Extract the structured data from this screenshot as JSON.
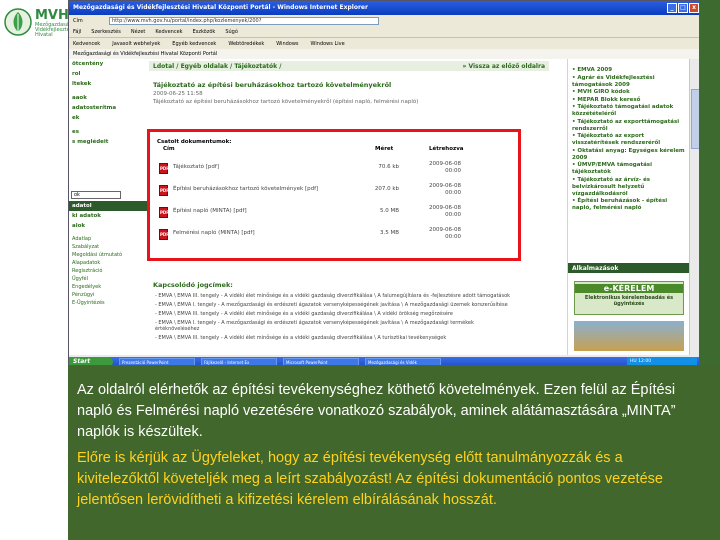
{
  "logo": {
    "title": "MVH",
    "subtitle": "Mezőgazdasági Vidékfejlesztési Hivatal"
  },
  "browser": {
    "title": "Mezőgazdasági és Vidékfejlesztési Hivatal Központi Portál - Windows Internet Explorer",
    "window_buttons": {
      "minimize": "_",
      "maximize": "□",
      "close": "x"
    },
    "address_label": "Cím",
    "address_value": "http://www.mvh.gov.hu/portal/index.php/kozlemenyek/200?",
    "menu": [
      "Fájl",
      "Szerkesztés",
      "Nézet",
      "Kedvencek",
      "Eszközök",
      "Súgó"
    ],
    "favorites": [
      "Kedvencek",
      "Javasolt webhelyek",
      "Egyéb kedvencek",
      "Webtöredékek",
      "Windows",
      "Windows Live"
    ],
    "tab": "Mezőgazdasági és Vidékfejlesztési Hivatal Központi Portál"
  },
  "left_nav": {
    "items": [
      "",
      "ötcentény",
      "rol",
      "ltekek",
      "",
      "aaok",
      "adatosterítma",
      "ek",
      "",
      "es",
      "s meglédeit",
      "",
      "",
      "",
      "",
      "",
      "",
      "",
      "",
      "",
      "",
      "",
      "ki adatok",
      "alok"
    ],
    "search_input_value": "ok",
    "search_label": "adatol",
    "sub_items": [
      "Adatlap",
      "Szabályzat",
      "Megoldási útmutató",
      "Alapadatok",
      "Regisztráció",
      "Ügyfél",
      "Engedélyek",
      "Pénzügyi",
      "E-Ügyintézés"
    ]
  },
  "breadcrumb": {
    "text": "Ldotal / Egyéb oldalak / Tájékoztatók /",
    "back_link": "» Vissza az előző oldalra"
  },
  "document": {
    "title": "Tájékoztató az építési beruházásokhoz tartozó követelményekről",
    "date": "2009-06-25 11:58",
    "description": "Tájékoztató az építési beruházásokhoz tartozó követelményekről (építési napló, felmérési napló)",
    "attachments_label": "Csatolt dokumentumok:",
    "col_name": "Cím",
    "col_size": "Méret",
    "col_date": "Létrehozva",
    "attachments": [
      {
        "name": "Tájékoztató [pdf]",
        "size": "70.6 kb",
        "date": "2009-06-08 00:00"
      },
      {
        "name": "Építési beruházásokhoz tartozó követelmények [pdf]",
        "size": "207.0 kb",
        "date": "2009-06-08 00:00"
      },
      {
        "name": "Építési napló (MINTA) [pdf]",
        "size": "5.0 MB",
        "date": "2009-06-08 00:00"
      },
      {
        "name": "Felmérési napló (MINTA) [pdf]",
        "size": "3.5 MB",
        "date": "2009-06-08 00:00"
      }
    ],
    "related_label": "Kapcsolódó jogcímek:",
    "related": [
      "- EMVA \\ EMVA III. tengely - A vidéki élet minősége és a vidéki gazdaság diverzifikálása \\ A falumegújításra és -fejlesztésre adott támogatások",
      "- EMVA \\ EMVA I. tengely - A mezőgazdasági és erdészeti ágazatok versenyképességének javítása \\ A mezőgazdasági üzemek korszerűsítése",
      "- EMVA \\ EMVA III. tengely - A vidéki élet minősége és a vidéki gazdaság diverzifikálása \\ A vidéki örökség megőrzésére",
      "- EMVA \\ EMVA I. tengely - A mezőgazdasági és erdészeti ágazatok versenyképességének javítása \\ A mezőgazdasági termékek értéknöveléséhez",
      "- EMVA \\ EMVA III. tengely - A vidéki élet minősége és a vidéki gazdaság diverzifikálása \\ A turisztikai tevékenységek"
    ]
  },
  "right_nav": {
    "items": [
      "• EMVA 2009",
      "• Agrár és Vidékfejlesztési támogatások 2009",
      "• MVH GIRO kódok",
      "• MEPAR Blokk kereső",
      "• Tájékoztató támogatási adatok közzétételéről",
      "• Tájékoztató az exporttámogatási rendszerről",
      "• Tájékoztató az export visszatérítések rendszeréről",
      "• Oktatási anyag: Egységes kérelem 2009",
      "• ÚMVP/EMVA támogatási tájékoztatók",
      "• Tájékoztató az árvíz- és belvízkárosult helyzetű vízgazdálkodásról",
      "• Építési beruházások - építési napló, felmérési napló"
    ],
    "apps_label": "Alkalmazások",
    "ek_title": "e-KÉRELEM",
    "ek_subtitle": "Elektronikus kérelembeadás és ügyintézés"
  },
  "taskbar": {
    "start": "Start",
    "items": [
      "Prezentáció PowerPoint",
      "Fájlkezelő - Internet Ex",
      "Microsoft PowerPoint",
      "Mezőgazdasági és Vidék"
    ],
    "tray": "HU 12:00"
  },
  "caption": {
    "p1": "Az oldalról elérhetők az építési tevékenységhez köthető követelmények. Ezen felül az Építési napló és Felmérési napló vezetésére vonatkozó szabályok, aminek alátámasztására „MINTA” naplók is készültek.",
    "p2": "Előre is kérjük az Ügyfeleket, hogy az építési tevékenység előtt tanulmányozzák és a kivitelezőktől követeljék meg a leírt szabályozást! Az építési dokumentáció pontos vezetése jelentősen lerövidítheti a kifizetési kérelem elbírálásának hosszát."
  },
  "colors": {
    "highlight": "#e8141c",
    "brand_green": "#2a6a1a",
    "panel_green": "#41672c",
    "caption_yellow": "#ffd21e"
  }
}
